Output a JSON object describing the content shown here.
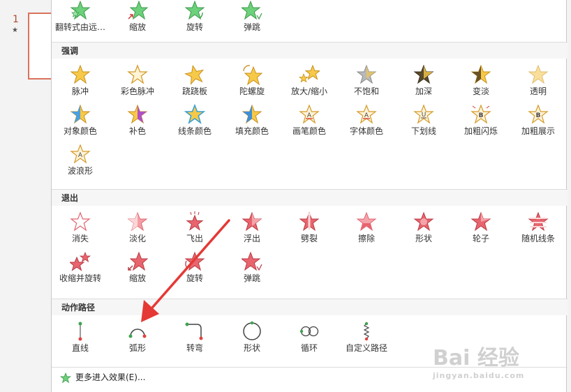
{
  "left_pane": {
    "slide_number": "1",
    "slide_marker": "★"
  },
  "entrance_tail": {
    "items": [
      {
        "label": "翻转式由远…",
        "icon": "star-entrance-flip-icon"
      },
      {
        "label": "缩放",
        "icon": "star-entrance-zoom-icon"
      },
      {
        "label": "旋转",
        "icon": "star-entrance-spin-icon"
      },
      {
        "label": "弹跳",
        "icon": "star-entrance-bounce-icon"
      }
    ]
  },
  "emphasis": {
    "title": "强调",
    "items": [
      {
        "label": "脉冲",
        "icon": "star-gold-icon"
      },
      {
        "label": "彩色脉冲",
        "icon": "star-outline-icon"
      },
      {
        "label": "跷跷板",
        "icon": "star-tilt-icon"
      },
      {
        "label": "陀螺旋",
        "icon": "star-spin-icon"
      },
      {
        "label": "放大/缩小",
        "icon": "star-grow-icon"
      },
      {
        "label": "不饱和",
        "icon": "star-gray-icon"
      },
      {
        "label": "加深",
        "icon": "star-dark-icon"
      },
      {
        "label": "变淡",
        "icon": "star-lighten-icon"
      },
      {
        "label": "透明",
        "icon": "star-transparent-icon"
      },
      {
        "label": "对象颜色",
        "icon": "star-blue-icon"
      },
      {
        "label": "补色",
        "icon": "star-purple-icon"
      },
      {
        "label": "线条颜色",
        "icon": "star-line-color-icon"
      },
      {
        "label": "填充颜色",
        "icon": "star-fill-color-icon"
      },
      {
        "label": "画笔颜色",
        "icon": "star-brush-color-icon"
      },
      {
        "label": "字体颜色",
        "icon": "star-font-color-icon"
      },
      {
        "label": "下划线",
        "icon": "star-underline-icon"
      },
      {
        "label": "加粗闪烁",
        "icon": "star-bold-flash-icon"
      },
      {
        "label": "加粗展示",
        "icon": "star-bold-reveal-icon"
      },
      {
        "label": "波浪形",
        "icon": "star-wave-icon"
      }
    ]
  },
  "exit": {
    "title": "退出",
    "items": [
      {
        "label": "消失",
        "icon": "star-exit-disappear-icon"
      },
      {
        "label": "淡化",
        "icon": "star-exit-fade-icon"
      },
      {
        "label": "飞出",
        "icon": "star-exit-fly-icon"
      },
      {
        "label": "浮出",
        "icon": "star-exit-float-icon"
      },
      {
        "label": "劈裂",
        "icon": "star-exit-split-icon"
      },
      {
        "label": "擦除",
        "icon": "star-exit-wipe-icon"
      },
      {
        "label": "形状",
        "icon": "star-exit-shape-icon"
      },
      {
        "label": "轮子",
        "icon": "star-exit-wheel-icon"
      },
      {
        "label": "随机线条",
        "icon": "star-exit-random-bars-icon"
      },
      {
        "label": "收缩并旋转",
        "icon": "star-exit-shrink-turn-icon"
      },
      {
        "label": "缩放",
        "icon": "star-exit-zoom-icon"
      },
      {
        "label": "旋转",
        "icon": "star-exit-spin-icon"
      },
      {
        "label": "弹跳",
        "icon": "star-exit-bounce-icon"
      }
    ]
  },
  "motion_paths": {
    "title": "动作路径",
    "items": [
      {
        "label": "直线",
        "icon": "path-line-icon"
      },
      {
        "label": "弧形",
        "icon": "path-arc-icon"
      },
      {
        "label": "转弯",
        "icon": "path-turn-icon"
      },
      {
        "label": "形状",
        "icon": "path-shape-icon"
      },
      {
        "label": "循环",
        "icon": "path-loop-icon"
      },
      {
        "label": "自定义路径",
        "icon": "path-custom-icon"
      }
    ]
  },
  "more_effects": {
    "label": "更多进入效果(E)..."
  },
  "watermark": {
    "main": "Bai 经验",
    "sub": "jingyan.baidu.com"
  },
  "colors": {
    "entrance_green": "#5cc46a",
    "emphasis_gold": "#f5c23a",
    "exit_red": "#e8656e",
    "path_red": "#e0433f",
    "path_green": "#3da34f",
    "arrow_red": "#e53935"
  }
}
